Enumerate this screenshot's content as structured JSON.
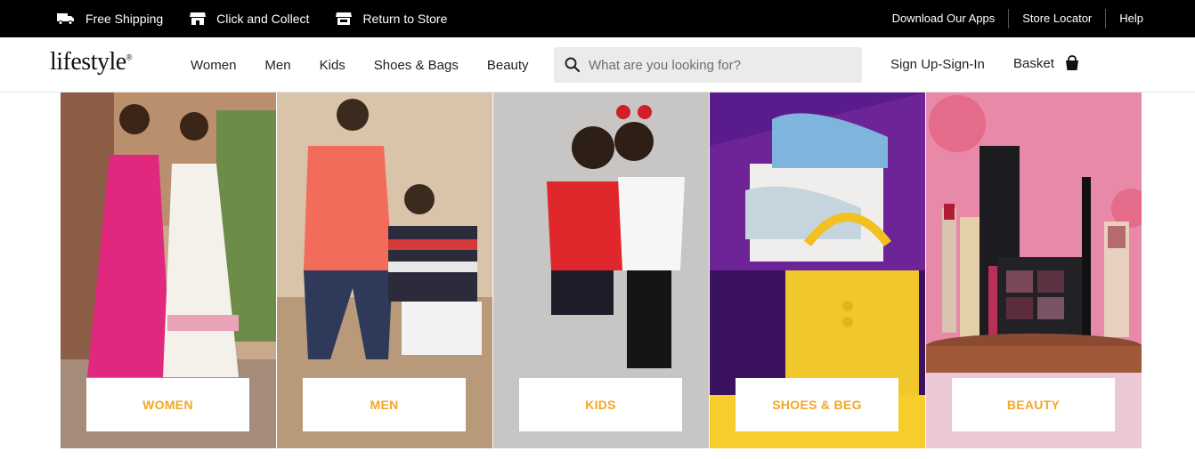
{
  "topbar": {
    "left": [
      {
        "label": "Free Shipping",
        "icon": "truck-icon"
      },
      {
        "label": "Click and Collect",
        "icon": "store-icon"
      },
      {
        "label": "Return to Store",
        "icon": "store-return-icon"
      }
    ],
    "right": [
      "Download Our Apps",
      "Store Locator",
      "Help"
    ]
  },
  "header": {
    "logo": "lifestyle",
    "nav": [
      "Women",
      "Men",
      "Kids",
      "Shoes & Bags",
      "Beauty"
    ],
    "search_placeholder": "What are you looking for?",
    "signin": "Sign Up-Sign-In",
    "basket": "Basket"
  },
  "tiles": [
    {
      "label": "WOMEN"
    },
    {
      "label": "MEN"
    },
    {
      "label": "KIDS"
    },
    {
      "label": "SHOES & BEG"
    },
    {
      "label": "BEAUTY"
    }
  ],
  "colors": {
    "topbar_bg": "#000000",
    "tile_label": "#f5a623",
    "search_bg": "#ebebeb"
  }
}
